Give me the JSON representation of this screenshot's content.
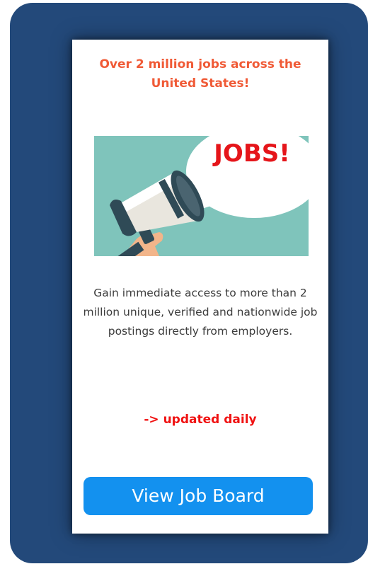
{
  "card": {
    "headline": "Over 2 million jobs across the United States!",
    "banner": {
      "icon": "megaphone-icon",
      "bubble_text": "JOBS!"
    },
    "description": "Gain immediate access to more than 2 million unique, verified and nationwide job postings directly from employers.",
    "updated_note": "-> updated daily",
    "cta_label": "View Job Board"
  },
  "colors": {
    "frame": "#23497a",
    "headline": "#f05a36",
    "banner_bg": "#7fc4bb",
    "bubble_text": "#e5151a",
    "updated_note": "#f01212",
    "cta_bg": "#1391ef"
  }
}
